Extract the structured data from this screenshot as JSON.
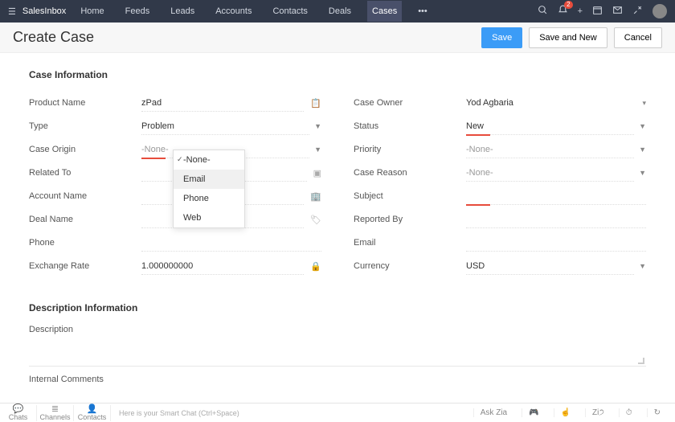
{
  "nav": {
    "brand": "SalesInbox",
    "items": [
      "Home",
      "Feeds",
      "Leads",
      "Accounts",
      "Contacts",
      "Deals",
      "Cases"
    ],
    "active": "Cases",
    "more": "•••",
    "badge": "2"
  },
  "header": {
    "title": "Create Case",
    "save": "Save",
    "save_new": "Save and New",
    "cancel": "Cancel"
  },
  "section1": "Case Information",
  "left": {
    "product_name_label": "Product Name",
    "product_name_value": "zPad",
    "type_label": "Type",
    "type_value": "Problem",
    "case_origin_label": "Case Origin",
    "case_origin_value": "-None-",
    "related_to_label": "Related To",
    "account_name_label": "Account Name",
    "deal_name_label": "Deal Name",
    "phone_label": "Phone",
    "exchange_rate_label": "Exchange Rate",
    "exchange_rate_value": "1.000000000"
  },
  "right": {
    "case_owner_label": "Case Owner",
    "case_owner_value": "Yod Agbaria",
    "status_label": "Status",
    "status_value": "New",
    "priority_label": "Priority",
    "priority_value": "-None-",
    "case_reason_label": "Case Reason",
    "case_reason_value": "-None-",
    "subject_label": "Subject",
    "reported_by_label": "Reported By",
    "email_label": "Email",
    "currency_label": "Currency",
    "currency_value": "USD"
  },
  "dropdown": {
    "options": [
      "-None-",
      "Email",
      "Phone",
      "Web"
    ],
    "selected": "-None-",
    "hover": "Email"
  },
  "section2": "Description Information",
  "desc": {
    "description_label": "Description",
    "internal_label": "Internal Comments"
  },
  "footer": {
    "items": [
      "Chats",
      "Channels",
      "Contacts"
    ],
    "smart": "Here is your Smart Chat (Ctrl+Space)",
    "ask": "Ask Zia",
    "r2": "Zi੭"
  }
}
